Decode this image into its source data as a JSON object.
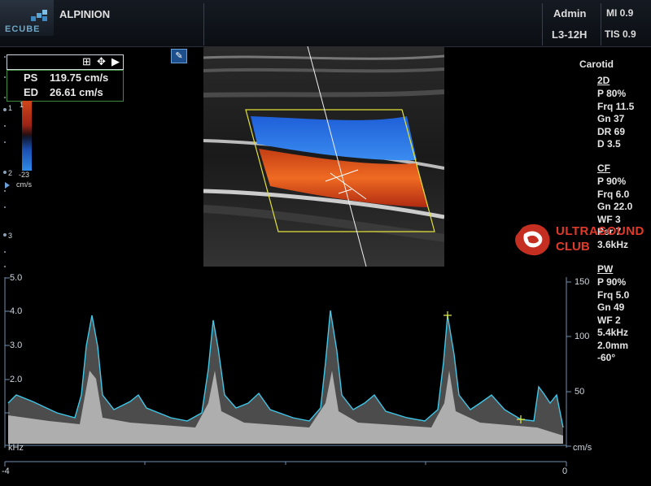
{
  "header": {
    "logo_label": "ECUBE",
    "brand": "ALPINION",
    "user": "Admin",
    "probe": "L3-12H",
    "mi": "MI 0.9",
    "tis": "TIS 0.9"
  },
  "measurement": {
    "ps_label": "PS",
    "ps_value": "119.75 cm/s",
    "ed_label": "ED",
    "ed_value": "26.61 cm/s"
  },
  "color_bar": {
    "top": "1",
    "bottom": "-23",
    "unit": "cm/s"
  },
  "depth_marks": [
    "1",
    "2",
    "3"
  ],
  "preset": "Carotid",
  "panel": {
    "b2d": {
      "title": "2D",
      "lines": [
        "P 80%",
        "Frq 11.5",
        "Gn 37",
        "DR 69",
        "D 3.5"
      ]
    },
    "cf": {
      "title": "CF",
      "lines": [
        "P 90%",
        "Frq 6.0",
        "Gn 22.0",
        "WF 3",
        "Per 7",
        "3.6kHz"
      ]
    },
    "pw": {
      "title": "PW",
      "lines": [
        "P 90%",
        "Frq 5.0",
        "Gn 49",
        "WF 2",
        "5.4kHz",
        "2.0mm",
        "-60°"
      ]
    }
  },
  "watermark": {
    "line1": "ULTRASOUND",
    "line2": "CLUB"
  },
  "spectrum": {
    "left_scale": [
      "5.0",
      "4.0",
      "3.0",
      "2.0"
    ],
    "left_unit": "kHz",
    "right_scale": [
      "150",
      "100",
      "50"
    ],
    "right_unit": "cm/s",
    "time_left": "-4",
    "time_right": "0"
  },
  "colors": {
    "flow_blue": "#2a6fe0",
    "flow_red": "#e0521c",
    "envelope": "#3fc7e8",
    "roi": "#e2e23a"
  }
}
